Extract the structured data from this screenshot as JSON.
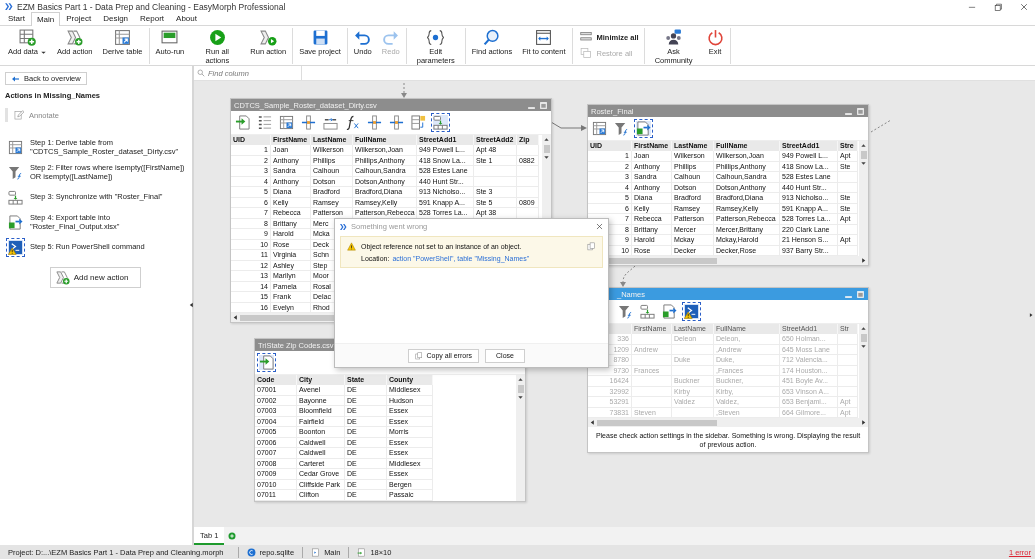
{
  "window": {
    "title": "EZM Basics Part 1 - Data Prep and Cleaning - EasyMorph Professional"
  },
  "menu_tabs": [
    {
      "label": "Start",
      "selected": false
    },
    {
      "label": "Main",
      "selected": true
    },
    {
      "label": "Project",
      "selected": false
    },
    {
      "label": "Design",
      "selected": false
    },
    {
      "label": "Report",
      "selected": false
    },
    {
      "label": "About",
      "selected": false
    }
  ],
  "ribbon": [
    {
      "stacked": false,
      "items": [
        {
          "kind": "add-data",
          "label": "Add data",
          "dropdown": true,
          "disabled": false
        },
        {
          "kind": "add-action",
          "label": "Add action",
          "dropdown": false,
          "disabled": false
        },
        {
          "kind": "derive",
          "label": "Derive table",
          "dropdown": false,
          "disabled": false
        }
      ]
    },
    {
      "stacked": false,
      "items": [
        {
          "kind": "autorun",
          "label": "Auto-run",
          "dropdown": false,
          "disabled": false
        },
        {
          "kind": "run-all",
          "label": "Run all actions",
          "dropdown": false,
          "disabled": false
        },
        {
          "kind": "run-action",
          "label": "Run action",
          "dropdown": false,
          "disabled": false
        }
      ]
    },
    {
      "stacked": false,
      "items": [
        {
          "kind": "save",
          "label": "Save project",
          "dropdown": false,
          "disabled": false
        }
      ]
    },
    {
      "stacked": false,
      "items": [
        {
          "kind": "undo",
          "label": "Undo",
          "dropdown": false,
          "disabled": false
        },
        {
          "kind": "redo",
          "label": "Redo",
          "dropdown": false,
          "disabled": true
        }
      ]
    },
    {
      "stacked": false,
      "items": [
        {
          "kind": "parameters",
          "label": "Edit parameters",
          "dropdown": false,
          "disabled": false
        }
      ]
    },
    {
      "stacked": false,
      "items": [
        {
          "kind": "find",
          "label": "Find actions",
          "dropdown": false,
          "disabled": false
        },
        {
          "kind": "fit",
          "label": "Fit to content",
          "dropdown": false,
          "disabled": false
        }
      ]
    },
    {
      "stacked": true,
      "items": [
        {
          "kind": "minimize-all",
          "label": "Minimize all",
          "dropdown": false,
          "disabled": false
        },
        {
          "kind": "restore-all",
          "label": "Restore all",
          "dropdown": false,
          "disabled": true
        }
      ]
    },
    {
      "stacked": false,
      "items": [
        {
          "kind": "community",
          "label": "Ask Community",
          "dropdown": false,
          "disabled": false
        },
        {
          "kind": "exit",
          "label": "Exit",
          "dropdown": false,
          "disabled": false
        }
      ]
    }
  ],
  "sidebar": {
    "back_button": "Back to overview",
    "heading": "Actions in Missing_Names",
    "annotate": "Annotate",
    "steps": [
      {
        "kind": "derive",
        "text": "Step 1: Derive table from \"CDTCS_Sample_Roster_dataset_Dirty.csv\"",
        "selected": false,
        "warning": false
      },
      {
        "kind": "filter",
        "text": "Step 2: Filter rows where isempty([FirstName]) OR isempty([LastName])",
        "selected": false,
        "warning": false
      },
      {
        "kind": "sync",
        "text": "Step 3: Synchronize with \"Roster_Final\"",
        "selected": false,
        "warning": false
      },
      {
        "kind": "export",
        "text": "Step 4: Export table into \"Roster_Final_Output.xlsx\"",
        "selected": false,
        "warning": false
      },
      {
        "kind": "powershell",
        "text": "Step 5: Run PowerShell command",
        "selected": true,
        "warning": true
      }
    ],
    "add_button": "Add new action"
  },
  "find_column": {
    "placeholder": "Find column"
  },
  "tables": [
    {
      "title": "CDTCS_Sample_Roster_dataset_Dirty.csv",
      "selected": false,
      "disabled": false,
      "actions": [
        {
          "kind": "import",
          "selected": false,
          "warning": false
        },
        {
          "kind": "select",
          "selected": false,
          "warning": false
        },
        {
          "kind": "derive",
          "selected": false,
          "warning": false
        },
        {
          "kind": "insert",
          "selected": false,
          "warning": false
        },
        {
          "kind": "rename",
          "selected": false,
          "warning": false
        },
        {
          "kind": "calc",
          "selected": false,
          "warning": false
        },
        {
          "kind": "insert",
          "selected": false,
          "warning": false
        },
        {
          "kind": "insert",
          "selected": false,
          "warning": false
        },
        {
          "kind": "pivot",
          "selected": false,
          "warning": false
        },
        {
          "kind": "sync",
          "selected": true,
          "warning": false
        }
      ],
      "columns": [
        "UID",
        "FirstName",
        "LastName",
        "FullName",
        "StreetAdd1",
        "StreetAdd2",
        "Zip"
      ],
      "rows": [
        [
          "1",
          "Joan",
          "Wilkerson",
          "Wilkerson,Joan",
          "949 Powell L...",
          "Apt 48",
          null
        ],
        [
          "2",
          "Anthony",
          "Phillips",
          "Phillips,Anthony",
          "418 Snow La...",
          "Ste 1",
          "0882"
        ],
        [
          "3",
          "Sandra",
          "Calhoun",
          "Calhoun,Sandra",
          "528 Estes Lane",
          null,
          null
        ],
        [
          "4",
          "Anthony",
          "Dotson",
          "Dotson,Anthony",
          "440 Hunt Str...",
          null,
          null
        ],
        [
          "5",
          "Diana",
          "Bradford",
          "Bradford,Diana",
          "913 Nicholso...",
          "Ste 3",
          null
        ],
        [
          "6",
          "Kelly",
          "Ramsey",
          "Ramsey,Kelly",
          "591 Knapp A...",
          "Ste 5",
          "0809"
        ],
        [
          "7",
          "Rebecca",
          "Patterson",
          "Patterson,Rebecca",
          "528 Torres La...",
          "Apt 38",
          null
        ],
        [
          "8",
          "Brittany",
          "Merc"
        ],
        [
          "9",
          "Harold",
          "Mcka"
        ],
        [
          "10",
          "Rose",
          "Deck"
        ],
        [
          "11",
          "Virginia",
          "Schn"
        ],
        [
          "12",
          "Ashley",
          "Step"
        ],
        [
          "13",
          "Marilyn",
          "Moor"
        ],
        [
          "14",
          "Pamela",
          "Rosal"
        ],
        [
          "15",
          "Frank",
          "Delac"
        ],
        [
          "16",
          "Evelyn",
          "Rhod"
        ]
      ]
    },
    {
      "title": "Roster_Final",
      "selected": false,
      "disabled": false,
      "actions": [
        {
          "kind": "derive",
          "selected": false,
          "warning": false
        },
        {
          "kind": "filter",
          "selected": false,
          "warning": false
        },
        {
          "kind": "export",
          "selected": true,
          "warning": false
        }
      ],
      "columns": [
        "UID",
        "FirstName",
        "LastName",
        "FullName",
        "StreetAdd1",
        "Stre"
      ],
      "rows": [
        [
          "1",
          "Joan",
          "Wilkerson",
          "Wilkerson,Joan",
          "949 Powell L...",
          "Apt"
        ],
        [
          "2",
          "Anthony",
          "Phillips",
          "Phillips,Anthony",
          "418 Snow La...",
          "Ste"
        ],
        [
          "3",
          "Sandra",
          "Calhoun",
          "Calhoun,Sandra",
          "528 Estes Lane",
          null
        ],
        [
          "4",
          "Anthony",
          "Dotson",
          "Dotson,Anthony",
          "440 Hunt Str...",
          null
        ],
        [
          "5",
          "Diana",
          "Bradford",
          "Bradford,Diana",
          "913 Nicholso...",
          "Ste"
        ],
        [
          "6",
          "Kelly",
          "Ramsey",
          "Ramsey,Kelly",
          "591 Knapp A...",
          "Ste"
        ],
        [
          "7",
          "Rebecca",
          "Patterson",
          "Patterson,Rebecca",
          "528 Torres La...",
          "Apt"
        ],
        [
          "8",
          "Brittany",
          "Mercer",
          "Mercer,Brittany",
          "220 Clark Lane",
          null
        ],
        [
          "9",
          "Harold",
          "Mckay",
          "Mckay,Harold",
          "21 Henson S...",
          "Apt"
        ],
        [
          "10",
          "Rose",
          "Decker",
          "Decker,Rose",
          "937 Barry Str...",
          null
        ]
      ]
    },
    {
      "title": "_Names",
      "selected": true,
      "disabled": true,
      "actions": [
        {
          "kind": "filter",
          "selected": false,
          "warning": false
        },
        {
          "kind": "sync",
          "selected": false,
          "warning": false
        },
        {
          "kind": "export",
          "selected": false,
          "warning": false
        },
        {
          "kind": "powershell",
          "selected": true,
          "warning": true
        }
      ],
      "columns": [
        "",
        "FirstName",
        "LastName",
        "FullName",
        "StreetAdd1",
        "Str"
      ],
      "rows": [
        [
          "336",
          null,
          "Deleon",
          "Deleon,",
          "650 Holman...",
          null
        ],
        [
          "1209",
          "Andrew",
          null,
          ",Andrew",
          "645 Moss Lane",
          null
        ],
        [
          "8780",
          null,
          "Duke",
          "Duke,",
          "712 Valencia...",
          null
        ],
        [
          "9730",
          "Frances",
          null,
          ",Frances",
          "174 Houston...",
          null
        ],
        [
          "16424",
          null,
          "Buckner",
          "Buckner,",
          "451 Boyle Av...",
          null
        ],
        [
          "32992",
          null,
          "Kirby",
          "Kirby,",
          "653 Vinson A...",
          null
        ],
        [
          "53291",
          null,
          "Valdez",
          "Valdez,",
          "653 Benjami...",
          "Apt"
        ],
        [
          "73831",
          "Steven",
          null,
          ",Steven",
          "664 Gilmore...",
          "Apt"
        ]
      ],
      "message": "Please check action settings in the sidebar. Something is wrong. Displaying the result of previous action."
    },
    {
      "title": "TriState Zip Codes.csv",
      "selected": false,
      "disabled": false,
      "actions": [
        {
          "kind": "import",
          "selected": true,
          "warning": false
        }
      ],
      "columns": [
        "Code",
        "City",
        "State",
        "County"
      ],
      "rows": [
        [
          "07001",
          "Avenel",
          "DE",
          "Middlesex"
        ],
        [
          "07002",
          "Bayonne",
          "DE",
          "Hudson"
        ],
        [
          "07003",
          "Bloomfield",
          "DE",
          "Essex"
        ],
        [
          "07004",
          "Fairfield",
          "DE",
          "Essex"
        ],
        [
          "07005",
          "Boonton",
          "DE",
          "Morris"
        ],
        [
          "07006",
          "Caldwell",
          "DE",
          "Essex"
        ],
        [
          "07007",
          "Caldwell",
          "DE",
          "Essex"
        ],
        [
          "07008",
          "Carteret",
          "DE",
          "Middlesex"
        ],
        [
          "07009",
          "Cedar Grove",
          "DE",
          "Essex"
        ],
        [
          "07010",
          "Cliffside Park",
          "DE",
          "Bergen"
        ],
        [
          "07011",
          "Clifton",
          "DE",
          "Passaic"
        ]
      ]
    }
  ],
  "dialog": {
    "title": "Something went wrong",
    "message": "Object reference not set to an instance of an object.",
    "location_label": "Location:",
    "location_link": "action \"PowerShell\", table \"Missing_Names\"",
    "buttons": [
      {
        "kind": "copy",
        "label": "Copy all errors"
      },
      {
        "kind": "plain",
        "label": "Close"
      }
    ]
  },
  "sheet_tabs": [
    {
      "label": "Tab 1",
      "selected": true
    }
  ],
  "status_bar": {
    "project": "Project: D:...\\EZM Basics Part 1 - Data Prep and Cleaning.morph",
    "repository": "repo.sqlite",
    "module": "Main",
    "size": "18×10",
    "errors": "1 error"
  }
}
